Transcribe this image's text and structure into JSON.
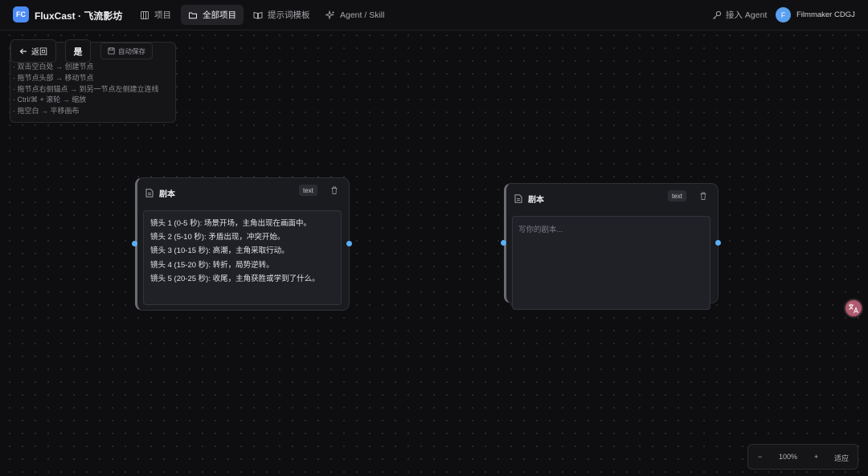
{
  "header": {
    "logo_badge": "FC",
    "app_title": "FluxCast · 飞流影坊",
    "tabs": [
      {
        "label": "项目",
        "icon": "grid-icon"
      },
      {
        "label": "全部项目",
        "icon": "folder-icon",
        "active": true
      },
      {
        "label": "提示词模板",
        "icon": "book-icon"
      },
      {
        "label": "Agent / Skill",
        "icon": "sparkle-icon"
      }
    ],
    "connect_agent": "接入 Agent",
    "avatar_initial": "F",
    "user_name": "Filmmaker CDGJ"
  },
  "toolbar": {
    "back_label": "返回",
    "yes_label": "是",
    "autosave_label": "自动保存"
  },
  "help": {
    "lines": [
      "· 双击空白处 → 创建节点",
      "· 拖节点头部 → 移动节点",
      "· 拖节点右侧锚点 → 到另一节点左侧建立连线",
      "· Ctrl/⌘ + 滚轮 → 缩放",
      "· 拖空白 → 平移画布"
    ]
  },
  "nodes": [
    {
      "title": "剧本",
      "type_badge": "text",
      "lines": [
        "镜头 1 (0-5 秒): 场景开场，主角出现在画面中。",
        "镜头 2 (5-10 秒): 矛盾出现，冲突开始。",
        "镜头 3 (10-15 秒): 高潮，主角采取行动。",
        "镜头 4 (15-20 秒): 转折，局势逆转。",
        "镜头 5 (20-25 秒): 收尾，主角获胜或学到了什么。"
      ]
    },
    {
      "title": "剧本",
      "type_badge": "text",
      "placeholder": "写你的剧本..."
    }
  ],
  "zoom": {
    "minus": "−",
    "level": "100%",
    "plus": "+",
    "fit": "适应"
  },
  "colors": {
    "accent": "#4c8bf5",
    "port": "#5ab0f5",
    "canvas": "#0e0e10"
  }
}
